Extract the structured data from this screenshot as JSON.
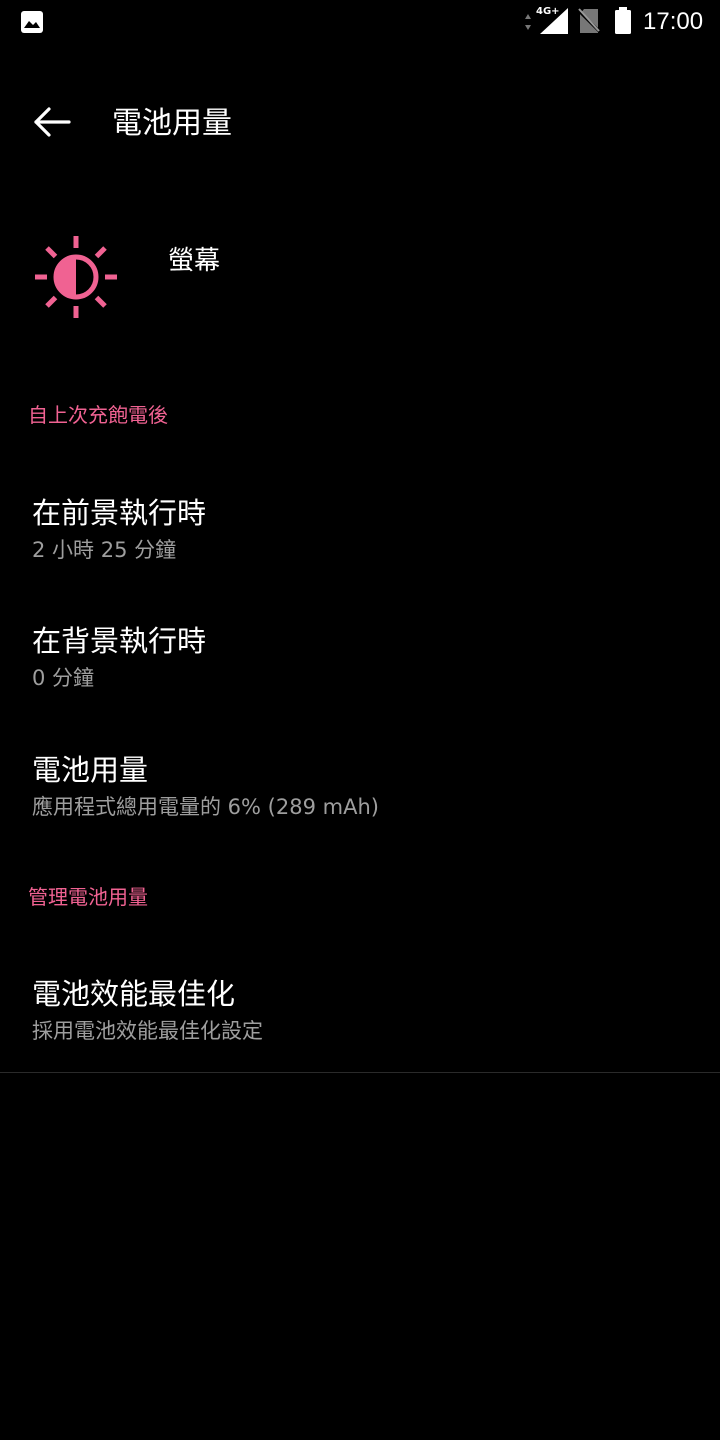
{
  "status_bar": {
    "network_type": "4G+",
    "time": "17:00"
  },
  "toolbar": {
    "title": "電池用量"
  },
  "app_header": {
    "icon": "brightness-icon",
    "name": "螢幕"
  },
  "section_since_charge": {
    "header": "自上次充飽電後",
    "items": [
      {
        "title": "在前景執行時",
        "summary": "2 小時 25 分鐘"
      },
      {
        "title": "在背景執行時",
        "summary": "0 分鐘"
      },
      {
        "title": "電池用量",
        "summary": "應用程式總用電量的 6% (289 mAh)"
      }
    ]
  },
  "section_manage": {
    "header": "管理電池用量",
    "items": [
      {
        "title": "電池效能最佳化",
        "summary": "採用電池效能最佳化設定"
      }
    ]
  },
  "colors": {
    "accent": "#f06292",
    "background": "#000000",
    "summary_text": "#9e9e9e"
  }
}
